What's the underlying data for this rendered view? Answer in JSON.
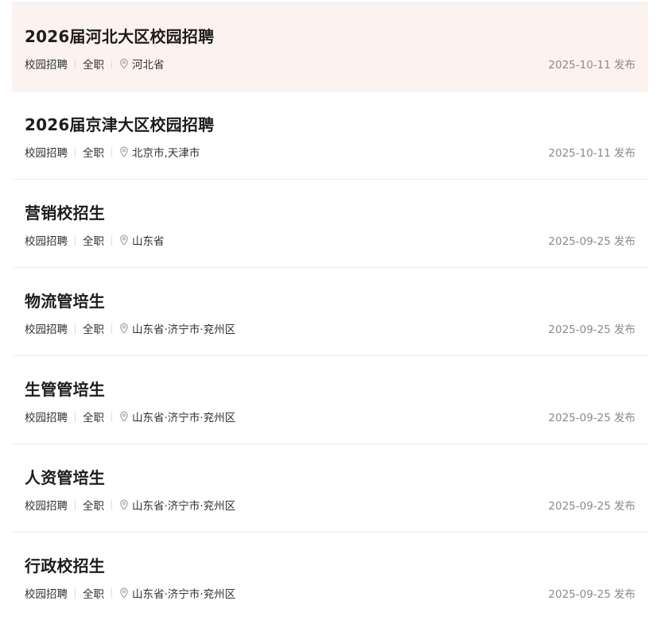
{
  "jobs": [
    {
      "title": "2026届河北大区校园招聘",
      "type": "校园招聘",
      "nature": "全职",
      "location": "河北省",
      "date": "2025-10-11",
      "suffix": "发布",
      "active": true
    },
    {
      "title": "2026届京津大区校园招聘",
      "type": "校园招聘",
      "nature": "全职",
      "location": "北京市,天津市",
      "date": "2025-10-11",
      "suffix": "发布",
      "active": false
    },
    {
      "title": "营销校招生",
      "type": "校园招聘",
      "nature": "全职",
      "location": "山东省",
      "date": "2025-09-25",
      "suffix": "发布",
      "active": false
    },
    {
      "title": "物流管培生",
      "type": "校园招聘",
      "nature": "全职",
      "location": "山东省·济宁市·兖州区",
      "date": "2025-09-25",
      "suffix": "发布",
      "active": false
    },
    {
      "title": "生管管培生",
      "type": "校园招聘",
      "nature": "全职",
      "location": "山东省·济宁市·兖州区",
      "date": "2025-09-25",
      "suffix": "发布",
      "active": false
    },
    {
      "title": "人资管培生",
      "type": "校园招聘",
      "nature": "全职",
      "location": "山东省·济宁市·兖州区",
      "date": "2025-09-25",
      "suffix": "发布",
      "active": false
    },
    {
      "title": "行政校招生",
      "type": "校园招聘",
      "nature": "全职",
      "location": "山东省·济宁市·兖州区",
      "date": "2025-09-25",
      "suffix": "发布",
      "active": false
    }
  ],
  "icons": {
    "location": "location-pin-icon"
  },
  "colors": {
    "active_background": "#fcf3f0",
    "divider": "#eeeeee",
    "date_text": "#8a8a8a"
  }
}
